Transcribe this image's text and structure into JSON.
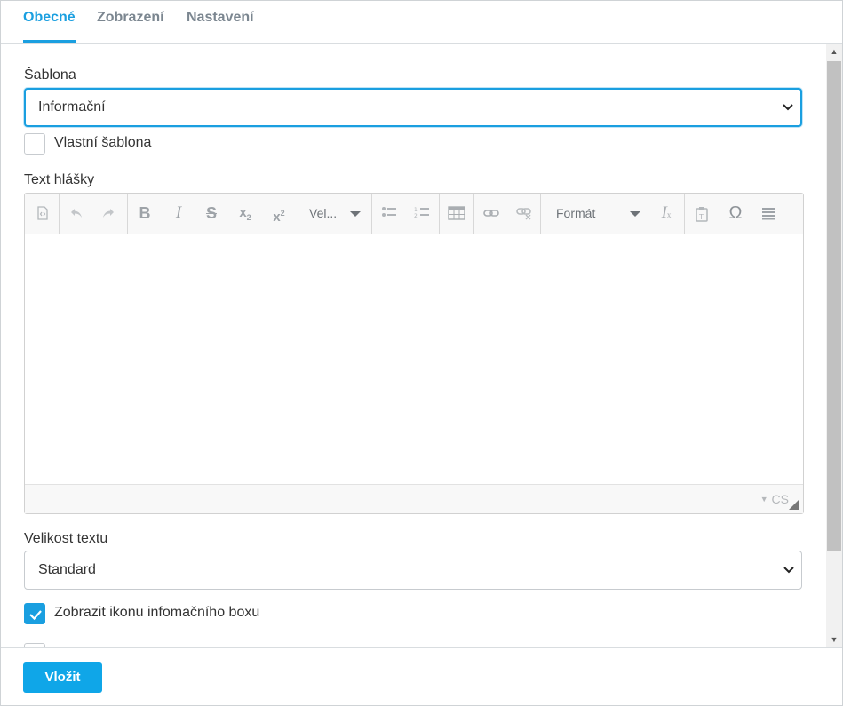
{
  "tabs": [
    {
      "label": "Obecné",
      "active": true
    },
    {
      "label": "Zobrazení",
      "active": false
    },
    {
      "label": "Nastavení",
      "active": false
    }
  ],
  "form": {
    "template": {
      "label": "Šablona",
      "value": "Informační"
    },
    "custom_template": {
      "label": "Vlastní šablona",
      "checked": false
    },
    "message_text": {
      "label": "Text hlášky"
    },
    "text_size": {
      "label": "Velikost textu",
      "value": "Standard"
    },
    "show_icon": {
      "label": "Zobrazit ikonu infomačního boxu",
      "checked": true
    }
  },
  "editor": {
    "size_combo": "Vel...",
    "format_combo": "Formát",
    "language": "CS",
    "toolbar_icons": [
      "source-icon",
      "undo-icon",
      "redo-icon",
      "bold-icon",
      "italic-icon",
      "strikethrough-icon",
      "subscript-icon",
      "superscript-icon",
      "bulleted-list-icon",
      "numbered-list-icon",
      "table-icon",
      "link-icon",
      "unlink-icon",
      "remove-format-icon",
      "paste-text-icon",
      "special-char-icon",
      "justify-icon"
    ]
  },
  "footer": {
    "submit_label": "Vložit"
  },
  "colors": {
    "accent": "#1a9fe0",
    "button": "#0fa6e8"
  }
}
